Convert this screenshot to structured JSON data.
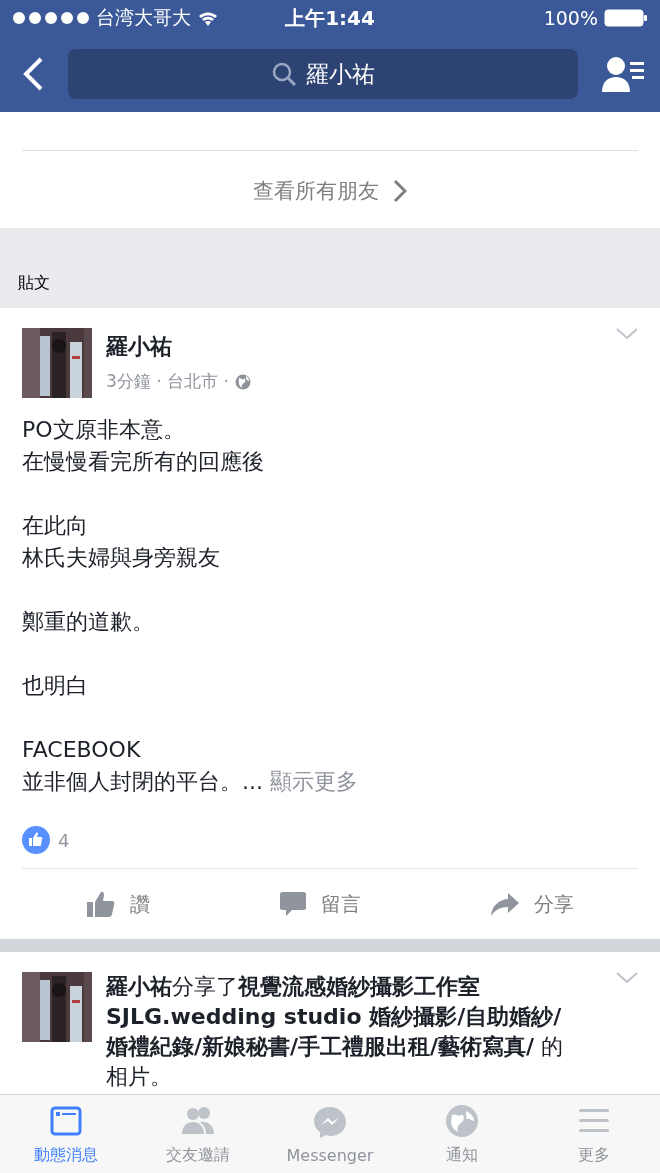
{
  "status_bar": {
    "carrier": "台湾大哥大",
    "time": "上午1:44",
    "battery": "100%"
  },
  "nav": {
    "search": "羅小祐"
  },
  "friends_link": "查看所有朋友",
  "section_title": "貼文",
  "posts": [
    {
      "kind": "status",
      "author": "羅小祐",
      "meta": "3分鐘 · 台北市 ·",
      "paragraphs": [
        [
          "PO文原非本意。",
          "在慢慢看完所有的回應後"
        ],
        [
          "在此向",
          "林氏夫婦與身旁親友"
        ],
        [
          "鄭重的道歉。"
        ],
        [
          "也明白"
        ],
        [
          "FACEBOOK",
          "並非個人封閉的平台。..."
        ]
      ],
      "see_more": "顯示更多",
      "likes": "4",
      "actions": [
        "讚",
        "留言",
        "分享"
      ]
    },
    {
      "kind": "share",
      "headline": "**羅小祐**分享了**視覺流感婚紗攝影工作室 SJLG.wedding studio 婚紗攝影/自助婚紗/婚禮紀錄/新娘秘書/手工禮服出租/藝術寫真/** 的相片。"
    }
  ],
  "tabs": [
    {
      "label": "動態消息",
      "selected": true
    },
    {
      "label": "交友邀請",
      "selected": false
    },
    {
      "label": "Messenger",
      "selected": false
    },
    {
      "label": "通知",
      "selected": false
    },
    {
      "label": "更多",
      "selected": false
    }
  ]
}
